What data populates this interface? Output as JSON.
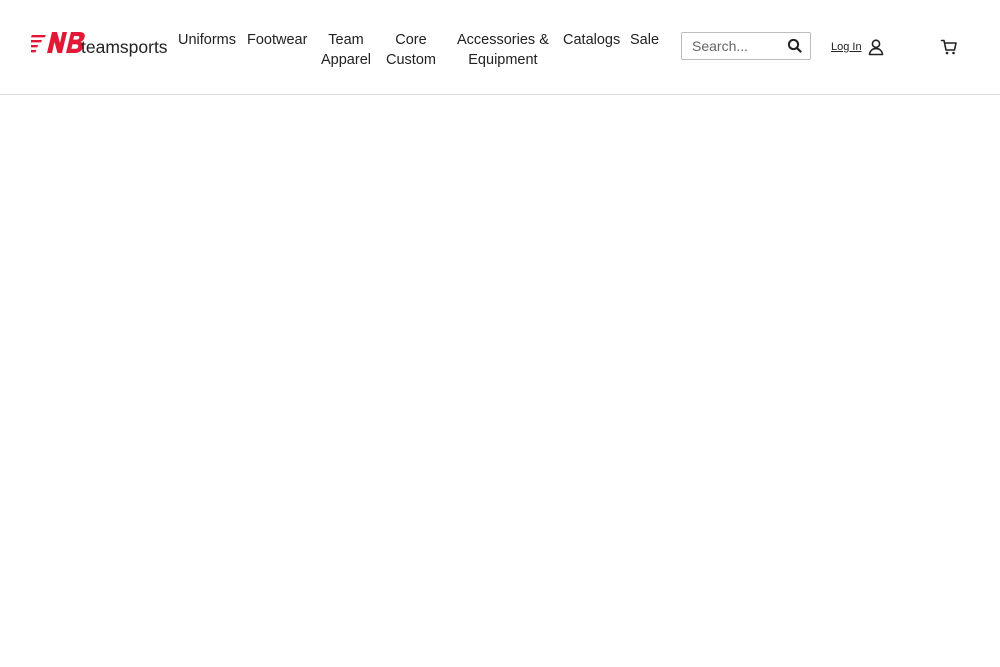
{
  "header": {
    "brand": {
      "logo_icon": "nb-logo-icon",
      "logo_text": "teamsports",
      "brand_color": "#e21836"
    },
    "nav": [
      {
        "lines": [
          "Uniforms"
        ]
      },
      {
        "lines": [
          "Footwear"
        ]
      },
      {
        "lines": [
          "Team",
          "Apparel"
        ]
      },
      {
        "lines": [
          "Core",
          "Custom"
        ]
      },
      {
        "lines": [
          "Accessories &",
          "Equipment"
        ]
      },
      {
        "lines": [
          "Catalogs"
        ]
      },
      {
        "lines": [
          "Sale"
        ]
      }
    ],
    "search": {
      "placeholder": "Search...",
      "value": "",
      "icon": "search-icon"
    },
    "account": {
      "login_label": "Log In",
      "icon": "user-icon"
    },
    "cart": {
      "icon": "cart-icon"
    }
  }
}
